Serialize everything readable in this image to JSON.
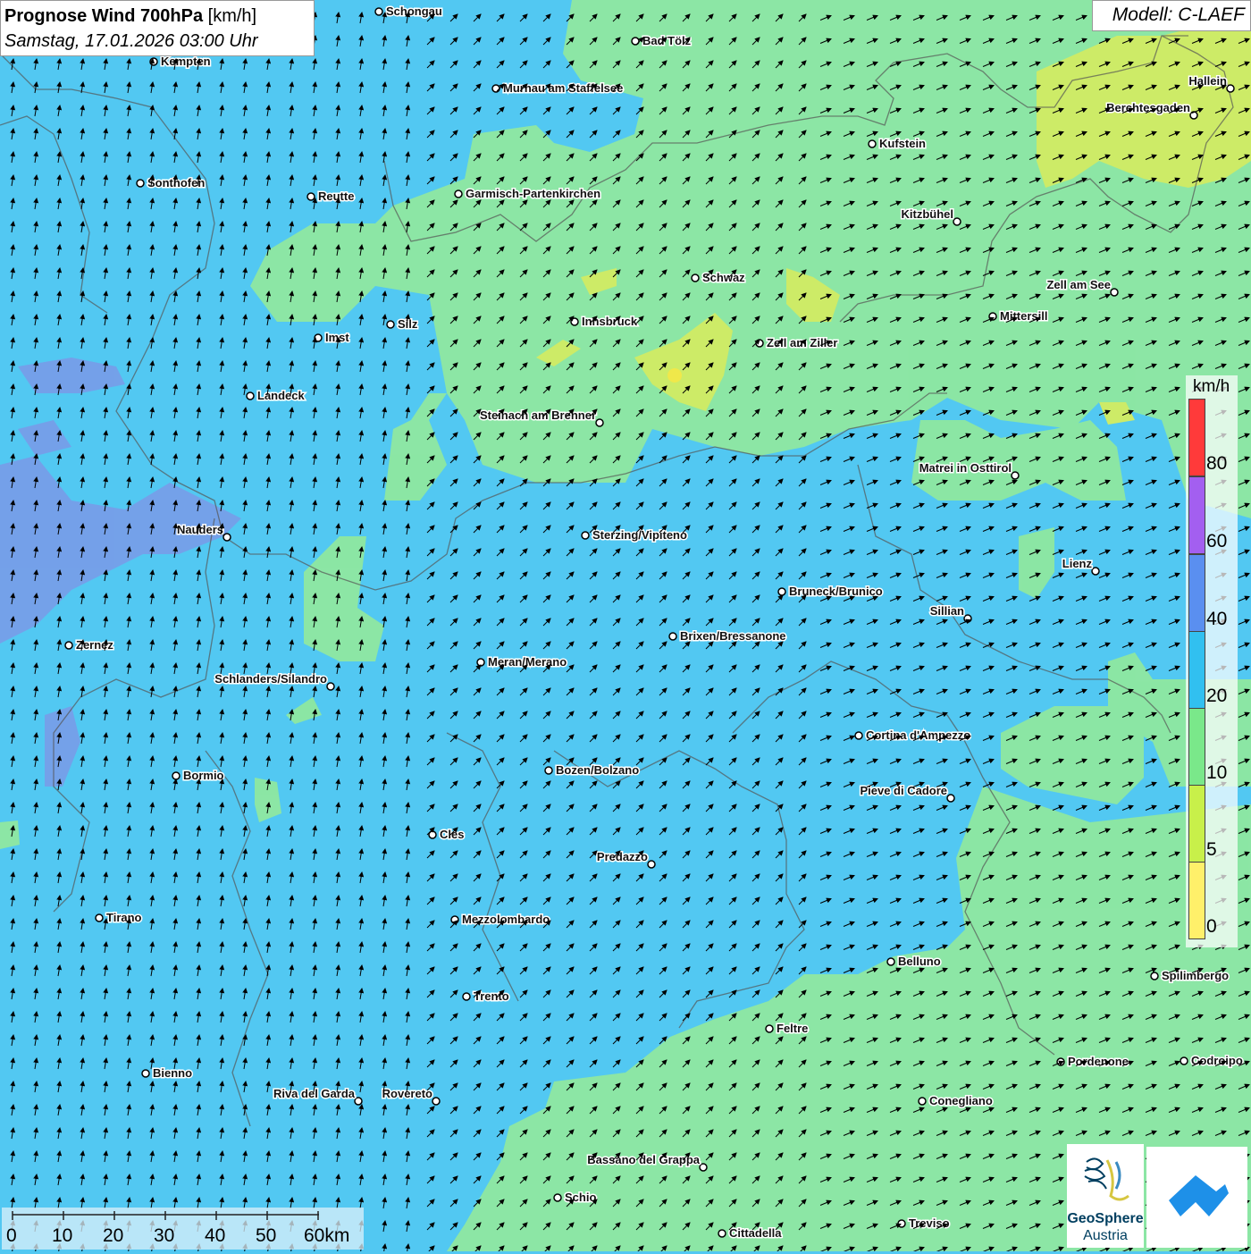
{
  "header": {
    "title_bold": "Prognose Wind 700hPa",
    "title_unit": "[km/h]",
    "subtitle": "Samstag, 17.01.2026 03:00 Uhr",
    "model": "Modell: C-LAEF"
  },
  "legend": {
    "unit": "km/h",
    "ticks": [
      "80",
      "60",
      "40",
      "20",
      "10",
      "5",
      "0"
    ],
    "colors": [
      "#ff3a3a",
      "#a35ff0",
      "#5a8ff0",
      "#31c0f0",
      "#7ae88a",
      "#c8f04a",
      "#fff06a"
    ]
  },
  "scale_bar": {
    "labels": [
      "0",
      "10",
      "20",
      "30",
      "40",
      "50",
      "60km"
    ]
  },
  "logos": {
    "geosphere_line1": "GeoSphere",
    "geosphere_line2": "Austria"
  },
  "cities": [
    {
      "name": "Schongau"
    },
    {
      "name": "Bad Tölz"
    },
    {
      "name": "Kempten"
    },
    {
      "name": "Murnau am Staffelsee"
    },
    {
      "name": "Hallein"
    },
    {
      "name": "Berchtesgaden"
    },
    {
      "name": "Kufstein"
    },
    {
      "name": "Sonthofen"
    },
    {
      "name": "Reutte"
    },
    {
      "name": "Garmisch-Partenkirchen"
    },
    {
      "name": "Kitzbühel"
    },
    {
      "name": "Schwaz"
    },
    {
      "name": "Zell am See"
    },
    {
      "name": "Mittersill"
    },
    {
      "name": "Imst"
    },
    {
      "name": "Silz"
    },
    {
      "name": "Innsbruck"
    },
    {
      "name": "Zell am Ziller"
    },
    {
      "name": "Landeck"
    },
    {
      "name": "Steinach am Brenner"
    },
    {
      "name": "Matrei in Osttirol"
    },
    {
      "name": "Nauders"
    },
    {
      "name": "Sterzing/Vipiteno"
    },
    {
      "name": "Lienz"
    },
    {
      "name": "Bruneck/Brunico"
    },
    {
      "name": "Sillian"
    },
    {
      "name": "Zernez"
    },
    {
      "name": "Brixen/Bressanone"
    },
    {
      "name": "Meran/Merano"
    },
    {
      "name": "Schlanders/Silandro"
    },
    {
      "name": "Cortina d'Ampezzo"
    },
    {
      "name": "Bormio"
    },
    {
      "name": "Bozen/Bolzano"
    },
    {
      "name": "Pieve di Cadore"
    },
    {
      "name": "Cles"
    },
    {
      "name": "Predazzo"
    },
    {
      "name": "Tirano"
    },
    {
      "name": "Mezzolombardo"
    },
    {
      "name": "Belluno"
    },
    {
      "name": "Spilimbergo"
    },
    {
      "name": "Trento"
    },
    {
      "name": "Feltre"
    },
    {
      "name": "Pordenone"
    },
    {
      "name": "Codroipo"
    },
    {
      "name": "Bienno"
    },
    {
      "name": "Riva del Garda"
    },
    {
      "name": "Rovereto"
    },
    {
      "name": "Conegliano"
    },
    {
      "name": "Bassano del Grappa"
    },
    {
      "name": "Schio"
    },
    {
      "name": "Treviso"
    },
    {
      "name": "Cittadella"
    }
  ],
  "colors": {
    "calm_yellow": "#fff06a",
    "wind_5_10": "#c8f04a",
    "wind_10_20": "#7ae88a",
    "wind_20_40": "#31c0f0",
    "wind_40_60": "#5a8ff0",
    "wind_60_80": "#a35ff0",
    "wind_80_plus": "#ff3a3a"
  }
}
